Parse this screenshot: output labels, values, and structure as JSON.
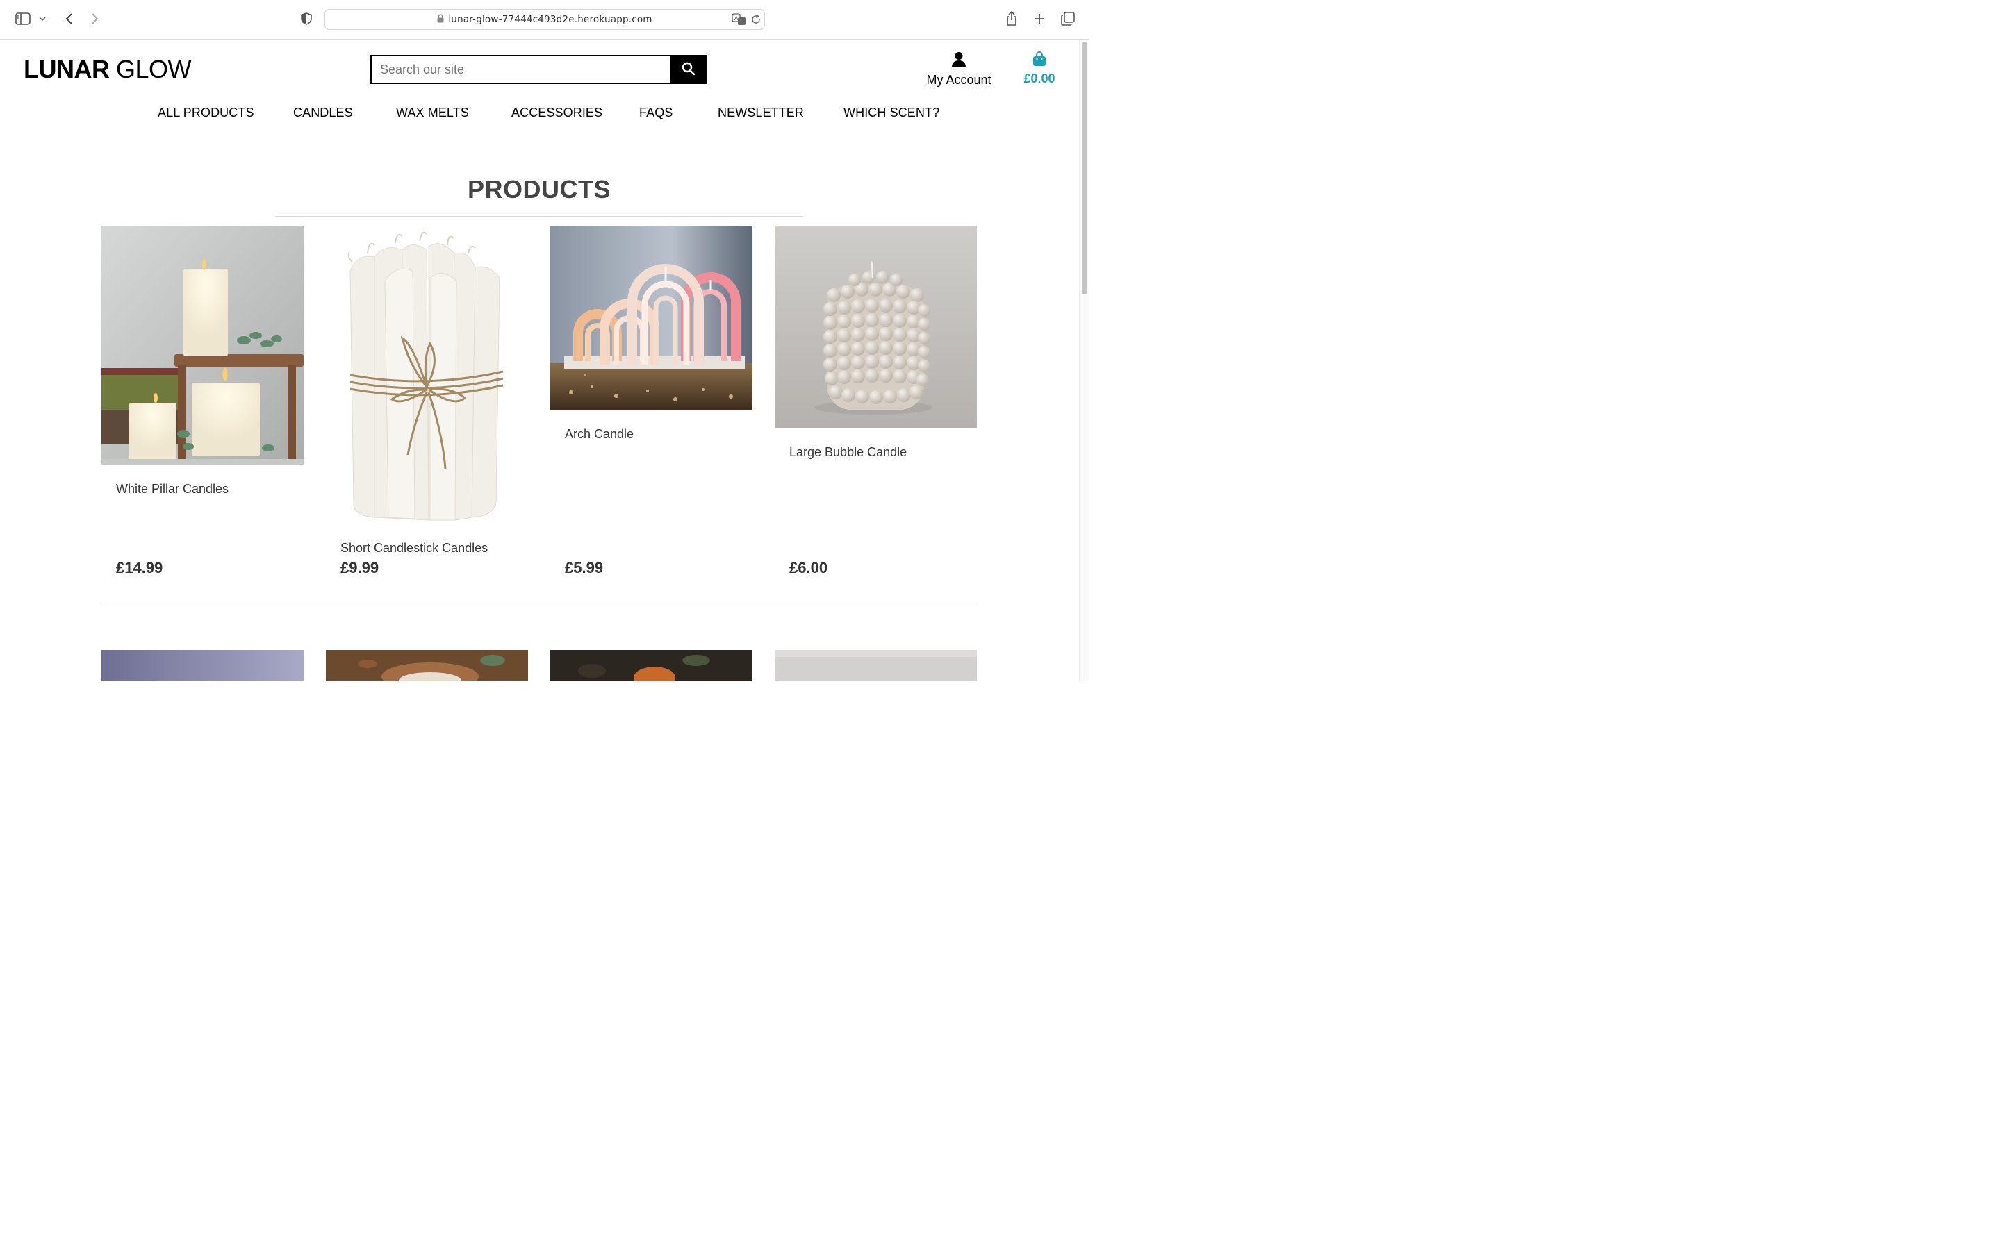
{
  "browser": {
    "url": "lunar-glow-77444c493d2e.herokuapp.com"
  },
  "header": {
    "logo_bold": "LUNAR",
    "logo_light": "GLOW",
    "search_placeholder": "Search our site",
    "account_label": "My Account",
    "bag_total": "£0.00",
    "accent_color": "#17a2b8"
  },
  "nav": {
    "items": [
      "ALL PRODUCTS",
      "CANDLES",
      "WAX MELTS",
      "ACCESSORIES",
      "FAQS",
      "NEWSLETTER",
      "WHICH SCENT?"
    ]
  },
  "main": {
    "title": "PRODUCTS",
    "products": [
      {
        "name": "White Pillar Candles",
        "price": "£14.99"
      },
      {
        "name": "Short Candlestick Candles",
        "price": "£9.99"
      },
      {
        "name": "Arch Candle",
        "price": "£5.99"
      },
      {
        "name": "Large Bubble Candle",
        "price": "£6.00"
      }
    ]
  }
}
